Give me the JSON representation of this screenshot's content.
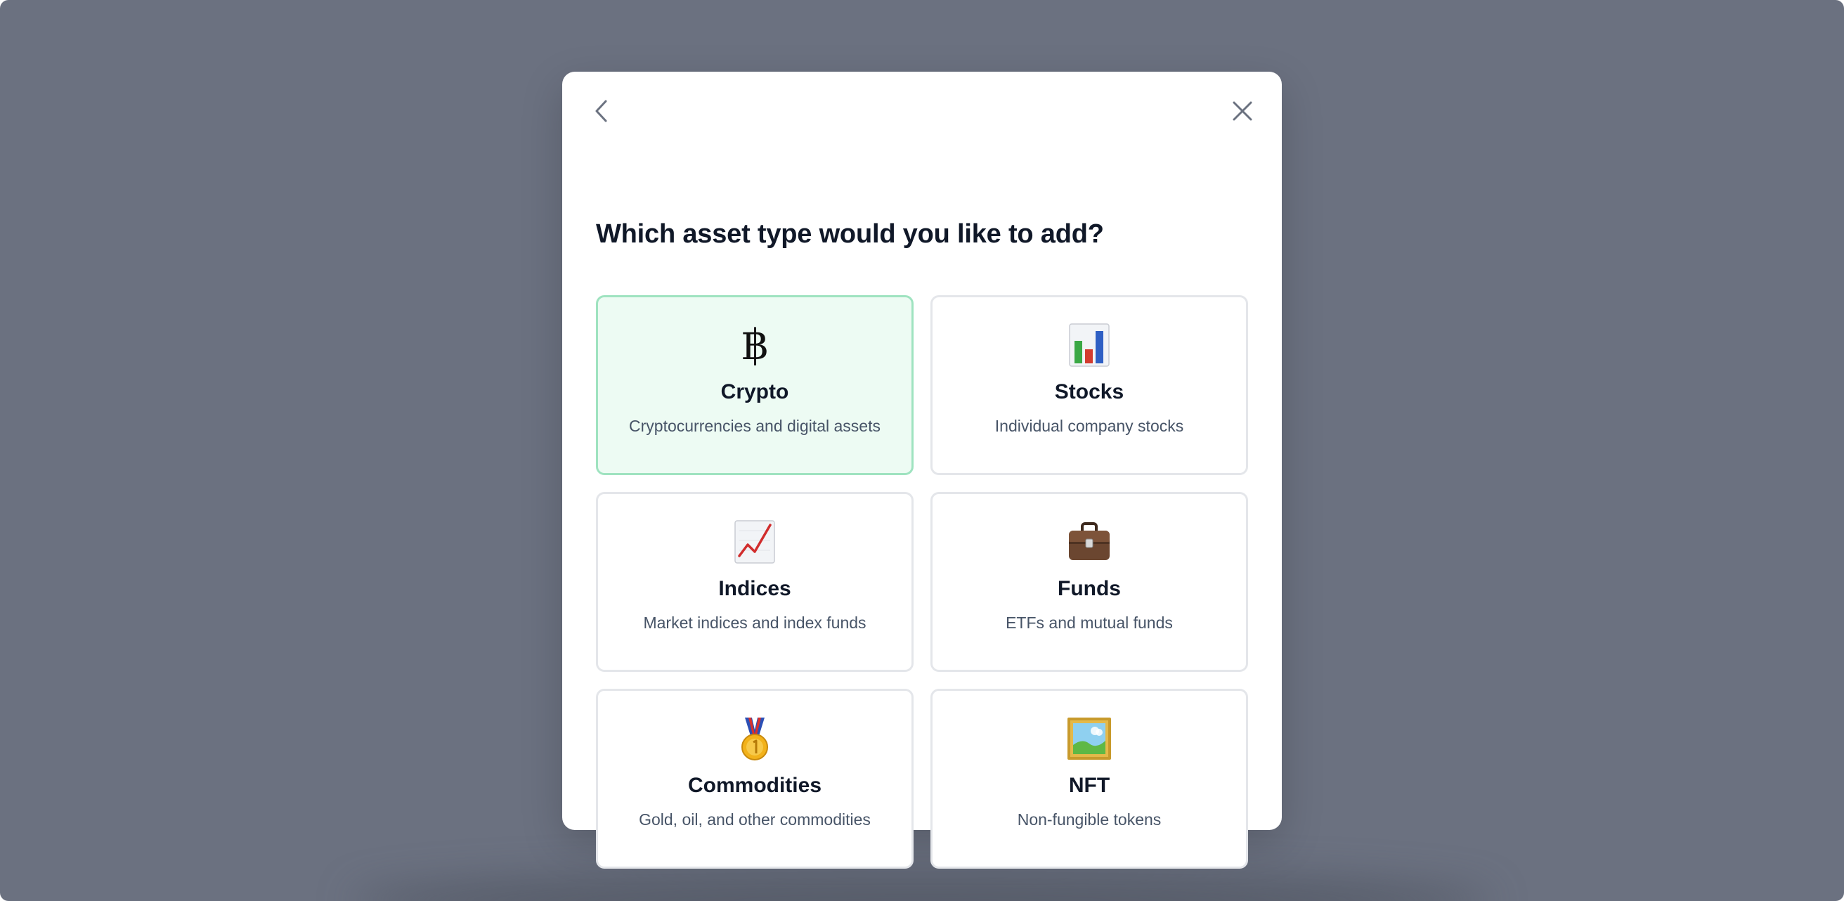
{
  "modal": {
    "title": "Which asset type would you like to add?",
    "back_icon": "chevron-left-icon",
    "close_icon": "close-icon"
  },
  "asset_types": [
    {
      "title": "Crypto",
      "description": "Cryptocurrencies and digital assets",
      "icon": "bitcoin-icon",
      "glyph": "฿",
      "selected": true
    },
    {
      "title": "Stocks",
      "description": "Individual company stocks",
      "icon": "bar-chart-icon",
      "selected": false
    },
    {
      "title": "Indices",
      "description": "Market indices and index funds",
      "icon": "chart-increasing-icon",
      "selected": false
    },
    {
      "title": "Funds",
      "description": "ETFs and mutual funds",
      "icon": "briefcase-icon",
      "selected": false
    },
    {
      "title": "Commodities",
      "description": "Gold, oil, and other commodities",
      "icon": "gold-medal-icon",
      "selected": false
    },
    {
      "title": "NFT",
      "description": "Non-fungible tokens",
      "icon": "framed-picture-icon",
      "selected": false
    }
  ],
  "colors": {
    "backdrop": "#6b7180",
    "selected_border": "#9fe3c0",
    "selected_background": "#edfbf3",
    "card_border": "#e4e6ea",
    "title_text": "#101828",
    "description_text": "#475467"
  }
}
